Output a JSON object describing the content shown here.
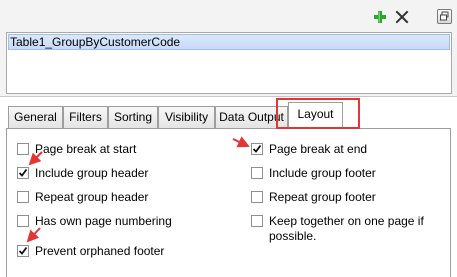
{
  "toolbar": {
    "add_icon": "green-plus-icon",
    "delete_icon": "x-delete-icon",
    "restore_icon": "restore-window-icon",
    "add_color": "#2ea52e",
    "delete_color": "#333333"
  },
  "groups": {
    "items": [
      {
        "label": "Table1_GroupByCustomerCode",
        "selected": true
      }
    ]
  },
  "tabs": [
    {
      "label": "General",
      "active": false
    },
    {
      "label": "Filters",
      "active": false
    },
    {
      "label": "Sorting",
      "active": false
    },
    {
      "label": "Visibility",
      "active": false
    },
    {
      "label": "Data Output",
      "active": false
    },
    {
      "label": "Layout",
      "active": true
    }
  ],
  "layout": {
    "page_break_at_start": {
      "label": "Page break at start",
      "checked": false
    },
    "include_group_header": {
      "label": "Include group header",
      "checked": true
    },
    "repeat_group_header": {
      "label": "Repeat group header",
      "checked": false
    },
    "has_own_page_numbering": {
      "label": "Has own page numbering",
      "checked": false
    },
    "prevent_orphaned_footer": {
      "label": "Prevent orphaned footer",
      "checked": true
    },
    "page_break_at_end": {
      "label": "Page break at end",
      "checked": true
    },
    "include_group_footer": {
      "label": "Include group footer",
      "checked": false
    },
    "repeat_group_footer": {
      "label": "Repeat group footer",
      "checked": false
    },
    "keep_together": {
      "label": "Keep together on one page if possible.",
      "checked": false
    }
  },
  "annotation_color": "#e53535"
}
